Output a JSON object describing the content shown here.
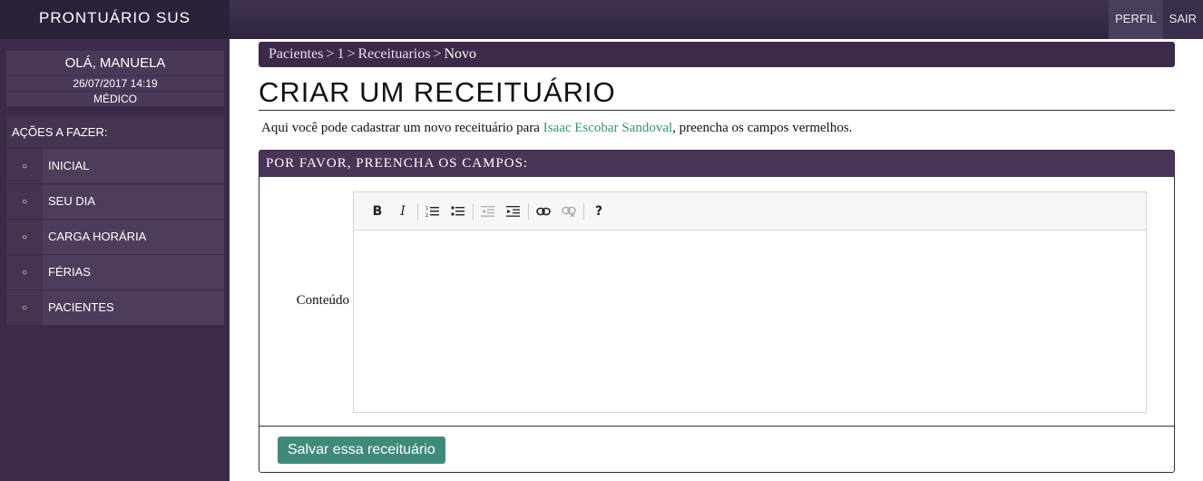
{
  "header": {
    "brand": "PRONTUÁRIO SUS",
    "nav": {
      "profile": "PERFIL",
      "logout": "SAIR"
    }
  },
  "sidebar": {
    "greeting": "OLÁ, MANUELA",
    "datetime": "26/07/2017 14:19",
    "role": "MÉDICO",
    "actions_title": "AÇÕES A FAZER:",
    "items": [
      {
        "label": "INICIAL"
      },
      {
        "label": "SEU DIA"
      },
      {
        "label": "CARGA HORÁRIA"
      },
      {
        "label": "FÉRIAS"
      },
      {
        "label": "PACIENTES"
      }
    ]
  },
  "breadcrumb": {
    "items": [
      "Pacientes",
      "1",
      "Receituarios"
    ],
    "separator": ">",
    "current": "Novo"
  },
  "page": {
    "title": "CRIAR UM RECEITUÁRIO",
    "intro_before": "Aqui você pode cadastrar um novo receituário para ",
    "patient_name": "Isaac Escobar Sandoval",
    "intro_after": ", preencha os campos vermelhos."
  },
  "form": {
    "panel_title": "POR FAVOR, PREENCHA OS CAMPOS:",
    "content_label": "Conteúdo",
    "content_value": "",
    "save_label": "Salvar essa receituário"
  },
  "editor_toolbar": [
    {
      "icon": "bold-icon",
      "glyph": "B"
    },
    {
      "icon": "italic-icon",
      "glyph": "I"
    },
    {
      "icon": "numbered-list-icon",
      "glyph": "≡"
    },
    {
      "icon": "bulleted-list-icon",
      "glyph": "≡"
    },
    {
      "icon": "outdent-icon",
      "glyph": "⇤"
    },
    {
      "icon": "indent-icon",
      "glyph": "⇥"
    },
    {
      "icon": "link-icon",
      "glyph": "∞"
    },
    {
      "icon": "unlink-icon",
      "glyph": "∞"
    },
    {
      "icon": "help-icon",
      "glyph": "?"
    }
  ],
  "colors": {
    "brand_purple": "#3d2a4a",
    "accent_teal": "#3f8a7a",
    "link_teal": "#3a8a82"
  }
}
